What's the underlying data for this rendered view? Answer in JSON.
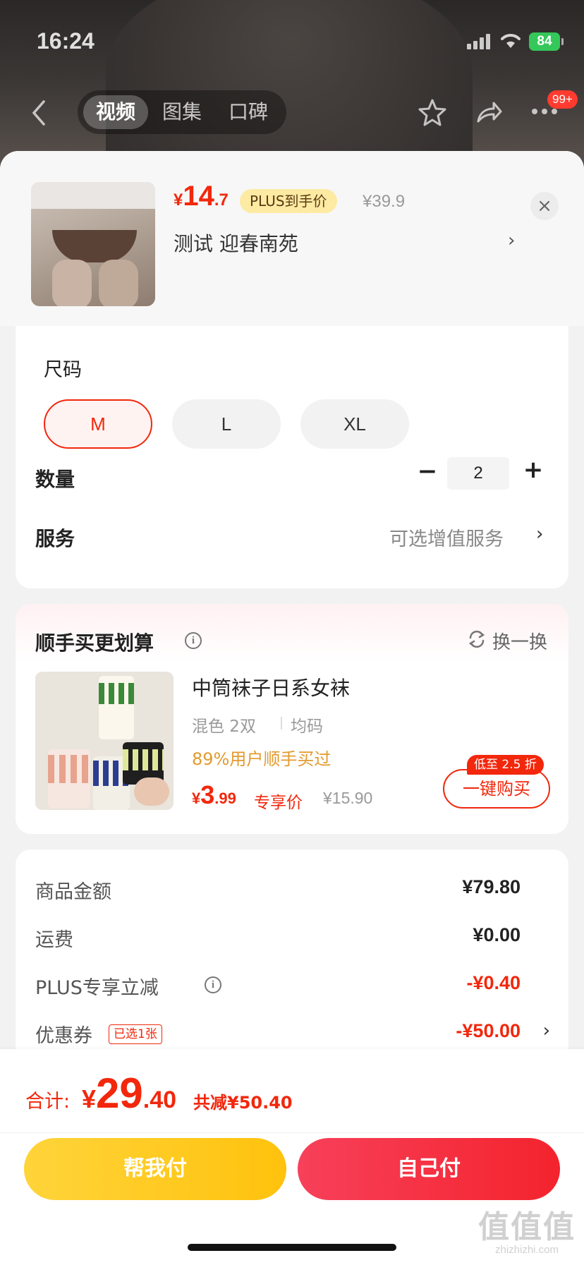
{
  "status_bar": {
    "time": "16:24",
    "battery": "84"
  },
  "nav": {
    "tabs": [
      {
        "label": "视频",
        "active": true
      },
      {
        "label": "图集",
        "active": false
      },
      {
        "label": "口碑",
        "active": false
      }
    ],
    "badge": "99+"
  },
  "product": {
    "price_currency": "¥",
    "price_int": "14",
    "price_dec": ".7",
    "plus_tag": "PLUS到手价",
    "original_price": "¥39.9",
    "spec_text": "测试  迎春南苑",
    "spec_arrow": "›",
    "close": "×"
  },
  "size": {
    "title": "尺码",
    "options": [
      {
        "label": "M",
        "selected": true
      },
      {
        "label": "L",
        "selected": false
      },
      {
        "label": "XL",
        "selected": false
      }
    ]
  },
  "quantity": {
    "label": "数量",
    "minus": "−",
    "value": "2",
    "plus": "+"
  },
  "service": {
    "label": "服务",
    "value": "可选增值服务",
    "arrow": "›"
  },
  "bundle": {
    "title": "顺手买更划算",
    "swap_label": "换一换",
    "item": {
      "name": "中筒袜子日系女袜",
      "spec_color": "混色 2双",
      "spec_size": "均码",
      "bought_text": "89%用户顺手买过",
      "price_currency": "¥",
      "price_int": "3",
      "price_dec": ".99",
      "exclusive_label": "专享价",
      "original_price": "¥15.90",
      "discount_tag": "低至 2.5 折",
      "buy_button": "一键购买"
    }
  },
  "summary": {
    "rows": [
      {
        "label": "商品金额",
        "value": "¥79.80"
      },
      {
        "label": "运费",
        "value": "¥0.00"
      },
      {
        "label": "PLUS专享立减",
        "value": "-¥0.40"
      },
      {
        "label": "优惠券",
        "value": "-¥50.00",
        "tag": "已选1张",
        "arrow": "›"
      }
    ]
  },
  "bottom": {
    "total_label": "合计:",
    "total_currency": "¥",
    "total_int": "29",
    "total_dec": ".40",
    "total_save": "共减¥50.40",
    "help_pay": "帮我付",
    "self_pay": "自己付"
  },
  "watermark": {
    "big": "值值值",
    "small": "zhizhizhi.com"
  },
  "colors": {
    "accent": "#f2270c",
    "plus_tag_bg": "#fdeaa3",
    "help_btn": "#ffc20d",
    "self_btn": "#f4232d"
  }
}
